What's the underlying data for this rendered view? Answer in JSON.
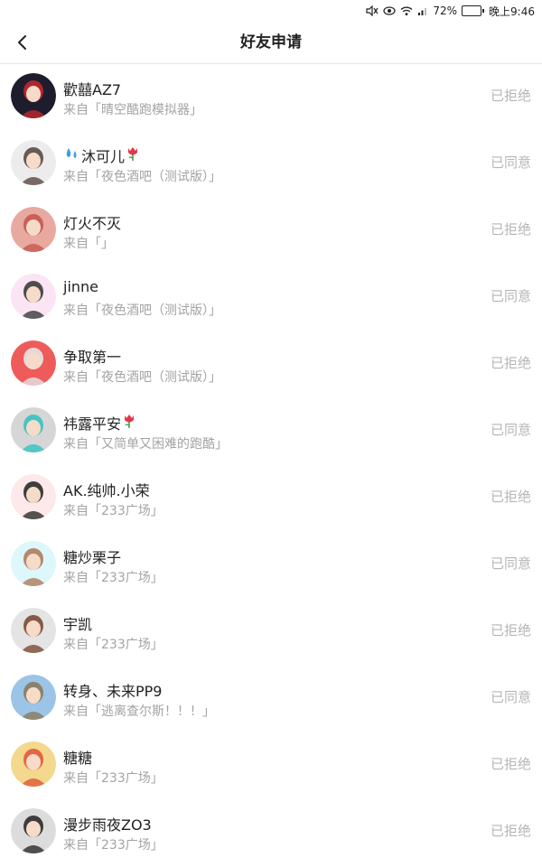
{
  "status_bar": {
    "battery_percent": "72%",
    "battery_level": 0.72,
    "time": "晚上9:46",
    "icons": [
      "mute-icon",
      "eye-icon",
      "wifi-icon",
      "signal-icon",
      "battery-icon"
    ]
  },
  "header": {
    "title": "好友申请",
    "back_icon": "back-arrow-icon"
  },
  "colors": {
    "name": "#222222",
    "source": "#a3a3a3",
    "status": "#b5b5b5",
    "divider": "#e6e6e6",
    "battery": "#2bb24c"
  },
  "requests": [
    {
      "name": "歡囍AZ7",
      "source": "来自「晴空酷跑模拟器」",
      "status": "已拒绝",
      "avatar_bg": "#1d1d2e",
      "avatar_accent": "#c2272d",
      "emoji": null
    },
    {
      "name": "沐可儿",
      "source": "来自「夜色酒吧（测试版）」",
      "status": "已同意",
      "avatar_bg": "#ececec",
      "avatar_accent": "#5a4a44",
      "emoji": "droplets-tulip"
    },
    {
      "name": "灯火不灭",
      "source": "来自「」",
      "status": "已拒绝",
      "avatar_bg": "#e8a9a0",
      "avatar_accent": "#c6574c",
      "emoji": null
    },
    {
      "name": "jinne",
      "source": "来自「夜色酒吧（测试版）」",
      "status": "已同意",
      "avatar_bg": "#fbe4f3",
      "avatar_accent": "#3b3b3b",
      "emoji": null
    },
    {
      "name": "争取第一",
      "source": "来自「夜色酒吧（测试版）」",
      "status": "已拒绝",
      "avatar_bg": "#ef5b5b",
      "avatar_accent": "#e5e5e5",
      "emoji": null
    },
    {
      "name": "祎露平安",
      "source": "来自「又简单又困难的跑酷」",
      "status": "已同意",
      "avatar_bg": "#d6d6d6",
      "avatar_accent": "#35c2c2",
      "emoji": "tulip"
    },
    {
      "name": "AK.纯帅.小荣",
      "source": "来自「233广场」",
      "status": "已拒绝",
      "avatar_bg": "#fde8ea",
      "avatar_accent": "#2a2a2a",
      "emoji": null
    },
    {
      "name": "糖炒栗子",
      "source": "来自「233广场」",
      "status": "已同意",
      "avatar_bg": "#ddf7fb",
      "avatar_accent": "#b07a5c",
      "emoji": null
    },
    {
      "name": "宇凯",
      "source": "来自「233广场」",
      "status": "已拒绝",
      "avatar_bg": "#e4e4e4",
      "avatar_accent": "#7b4a32",
      "emoji": null
    },
    {
      "name": "转身、未来PP9",
      "source": "来自「逃离查尔斯！！！」",
      "status": "已同意",
      "avatar_bg": "#9bc4e6",
      "avatar_accent": "#8a7b5e",
      "emoji": null
    },
    {
      "name": "糖糖",
      "source": "来自「233广场」",
      "status": "已拒绝",
      "avatar_bg": "#f3d88d",
      "avatar_accent": "#e05a3a",
      "emoji": null
    },
    {
      "name": "漫步雨夜ZO3",
      "source": "来自「233广场」",
      "status": "已拒绝",
      "avatar_bg": "#dcdcdc",
      "avatar_accent": "#2b2b2b",
      "emoji": null
    }
  ]
}
